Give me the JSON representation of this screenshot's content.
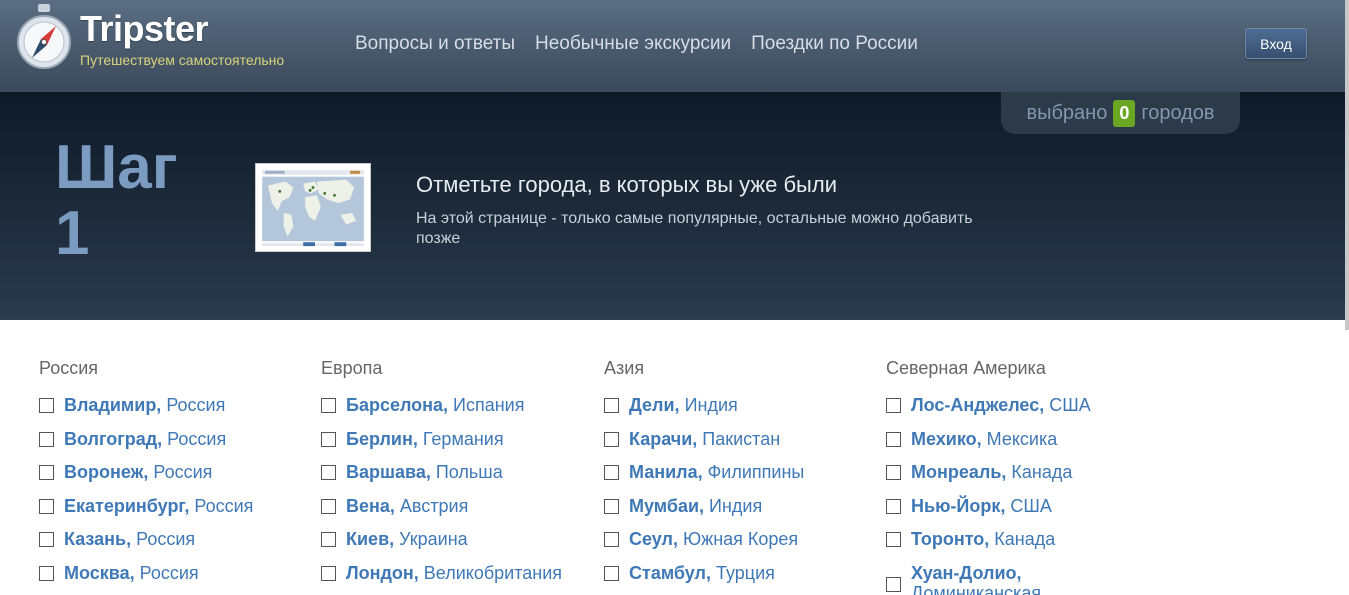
{
  "header": {
    "brand": "Tripster",
    "tagline": "Путешествуем самостоятельно",
    "nav": [
      "Вопросы и ответы",
      "Необычные экскурсии",
      "Поездки по России"
    ],
    "login": "Вход"
  },
  "selection": {
    "prefix": "выбрано",
    "count": "0",
    "suffix": "городов"
  },
  "hero": {
    "step_word": "Шаг",
    "step_num": "1",
    "title": "Отметьте города, в которых вы уже были",
    "subtitle": "На этой странице - только самые популярные, остальные можно добавить позже"
  },
  "regions": [
    {
      "title": "Россия",
      "cities": [
        {
          "name": "Владимир,",
          "country": "Россия"
        },
        {
          "name": "Волгоград,",
          "country": "Россия"
        },
        {
          "name": "Воронеж,",
          "country": "Россия"
        },
        {
          "name": "Екатеринбург,",
          "country": "Россия"
        },
        {
          "name": "Казань,",
          "country": "Россия"
        },
        {
          "name": "Москва,",
          "country": "Россия"
        }
      ]
    },
    {
      "title": "Европа",
      "cities": [
        {
          "name": "Барселона,",
          "country": "Испания"
        },
        {
          "name": "Берлин,",
          "country": "Германия"
        },
        {
          "name": "Варшава,",
          "country": "Польша"
        },
        {
          "name": "Вена,",
          "country": "Австрия"
        },
        {
          "name": "Киев,",
          "country": "Украина"
        },
        {
          "name": "Лондон,",
          "country": "Великобритания"
        }
      ]
    },
    {
      "title": "Азия",
      "cities": [
        {
          "name": "Дели,",
          "country": "Индия"
        },
        {
          "name": "Карачи,",
          "country": "Пакистан"
        },
        {
          "name": "Манила,",
          "country": "Филиппины"
        },
        {
          "name": "Мумбаи,",
          "country": "Индия"
        },
        {
          "name": "Сеул,",
          "country": "Южная Корея"
        },
        {
          "name": "Стамбул,",
          "country": "Турция"
        }
      ]
    },
    {
      "title": "Северная Америка",
      "cities": [
        {
          "name": "Лос-Анджелес,",
          "country": "США"
        },
        {
          "name": "Мехико,",
          "country": "Мексика"
        },
        {
          "name": "Монреаль,",
          "country": "Канада"
        },
        {
          "name": "Нью-Йорк,",
          "country": "США"
        },
        {
          "name": "Торонто,",
          "country": "Канада"
        },
        {
          "name": "Хуан-Долио,",
          "country": "Доминиканская"
        }
      ]
    }
  ]
}
